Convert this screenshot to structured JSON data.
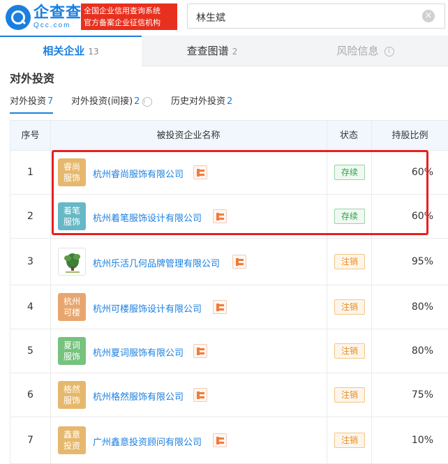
{
  "header": {
    "logo_main": "企查查",
    "logo_sub": "Qcc.com",
    "badge_line1": "全国企业信用查询系统",
    "badge_line2": "官方备案企业征信机构",
    "search_value": "林生斌"
  },
  "tabs": [
    {
      "label": "相关企业",
      "count": "13",
      "active": true
    },
    {
      "label": "查查图谱",
      "count": "2",
      "active": false
    },
    {
      "label": "风险信息",
      "count": "",
      "active": false
    }
  ],
  "section": {
    "title": "对外投资",
    "subtabs": [
      {
        "label": "对外投资",
        "count": "7"
      },
      {
        "label": "对外投资(间接)",
        "count": "2"
      },
      {
        "label": "历史对外投资",
        "count": "2"
      }
    ]
  },
  "table": {
    "headers": [
      "序号",
      "被投资企业名称",
      "状态",
      "持股比例"
    ],
    "rows": [
      {
        "seq": "1",
        "logo": "睿尚服饰",
        "logo_color": "#e6b86d",
        "name": "杭州睿尚服饰有限公司",
        "status": "存续",
        "status_type": "ok",
        "pct": "60%"
      },
      {
        "seq": "2",
        "logo": "着笔服饰",
        "logo_color": "#67b8c6",
        "name": "杭州着笔服饰设计有限公司",
        "status": "存续",
        "status_type": "ok",
        "pct": "60%"
      },
      {
        "seq": "3",
        "logo": "",
        "logo_color": "",
        "name": "杭州乐活几何品牌管理有限公司",
        "status": "注销",
        "status_type": "cancel",
        "pct": "95%"
      },
      {
        "seq": "4",
        "logo": "杭州可楼",
        "logo_color": "#e8a66f",
        "name": "杭州可楼服饰设计有限公司",
        "status": "注销",
        "status_type": "cancel",
        "pct": "80%"
      },
      {
        "seq": "5",
        "logo": "夏词服饰",
        "logo_color": "#76c27e",
        "name": "杭州夏词服饰有限公司",
        "status": "注销",
        "status_type": "cancel",
        "pct": "80%"
      },
      {
        "seq": "6",
        "logo": "格然服饰",
        "logo_color": "#e6b86d",
        "name": "杭州格然服饰有限公司",
        "status": "注销",
        "status_type": "cancel",
        "pct": "75%"
      },
      {
        "seq": "7",
        "logo": "鑫意投资",
        "logo_color": "#e6b86d",
        "name": "广州鑫意投资顾问有限公司",
        "status": "注销",
        "status_type": "cancel",
        "pct": "10%"
      }
    ]
  },
  "colors": {
    "brand": "#1a7fe0",
    "badge_red": "#e8301e",
    "highlight": "#e81f1f",
    "status_ok": "#2ba245",
    "status_cancel": "#ea8a1e"
  }
}
